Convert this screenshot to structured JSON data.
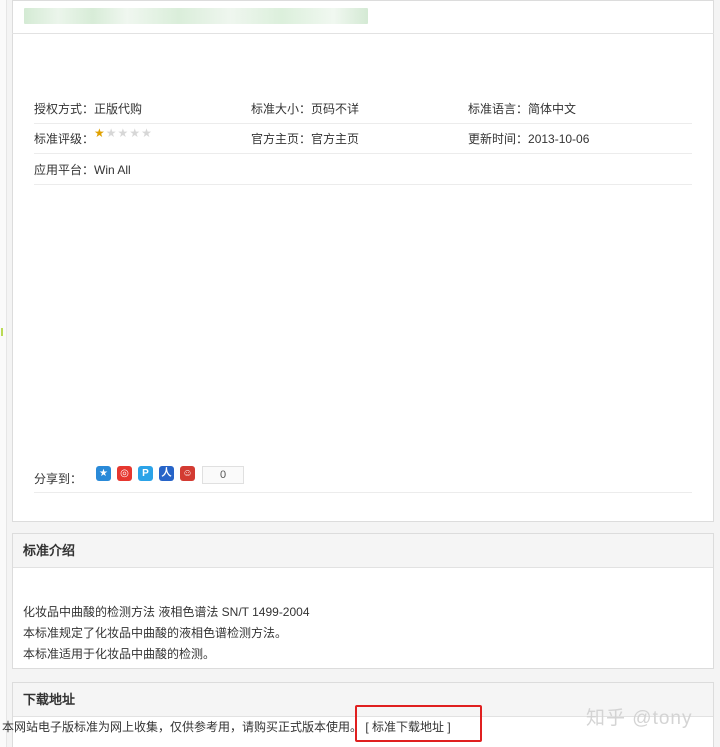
{
  "details": {
    "auth_label": "授权方式：",
    "auth_value": "正版代购",
    "size_label": "标准大小：",
    "size_value": "页码不详",
    "lang_label": "标准语言：",
    "lang_value": "简体中文",
    "rating_label": "标准评级：",
    "rating_stars": 1,
    "rating_max": 5,
    "home_label": "官方主页：",
    "home_value": "官方主页",
    "updated_label": "更新时间：",
    "updated_value": "2013-10-06",
    "platform_label": "应用平台：",
    "platform_value": "Win All"
  },
  "share": {
    "label": "分享到：",
    "icons": [
      "qzone-icon",
      "weibo-icon",
      "tencent-weibo-icon",
      "baidu-icon",
      "renren-icon"
    ],
    "count": "0"
  },
  "intro": {
    "heading": "标准介绍",
    "line1": "化妆品中曲酸的检测方法 液相色谱法  SN/T 1499-2004",
    "line2": "本标准规定了化妆品中曲酸的液相色谱检测方法。",
    "line3": "本标准适用于化妆品中曲酸的检测。"
  },
  "download": {
    "heading": "下载地址",
    "notice": "本网站电子版标准为网上收集，仅供参考用，请购买正式版本使用。",
    "link_label": "[ 标准下载地址 ]"
  },
  "watermark": "知乎 @tony",
  "colors": {
    "highlight_box": "#e02020",
    "star_on": "#e0a100"
  }
}
